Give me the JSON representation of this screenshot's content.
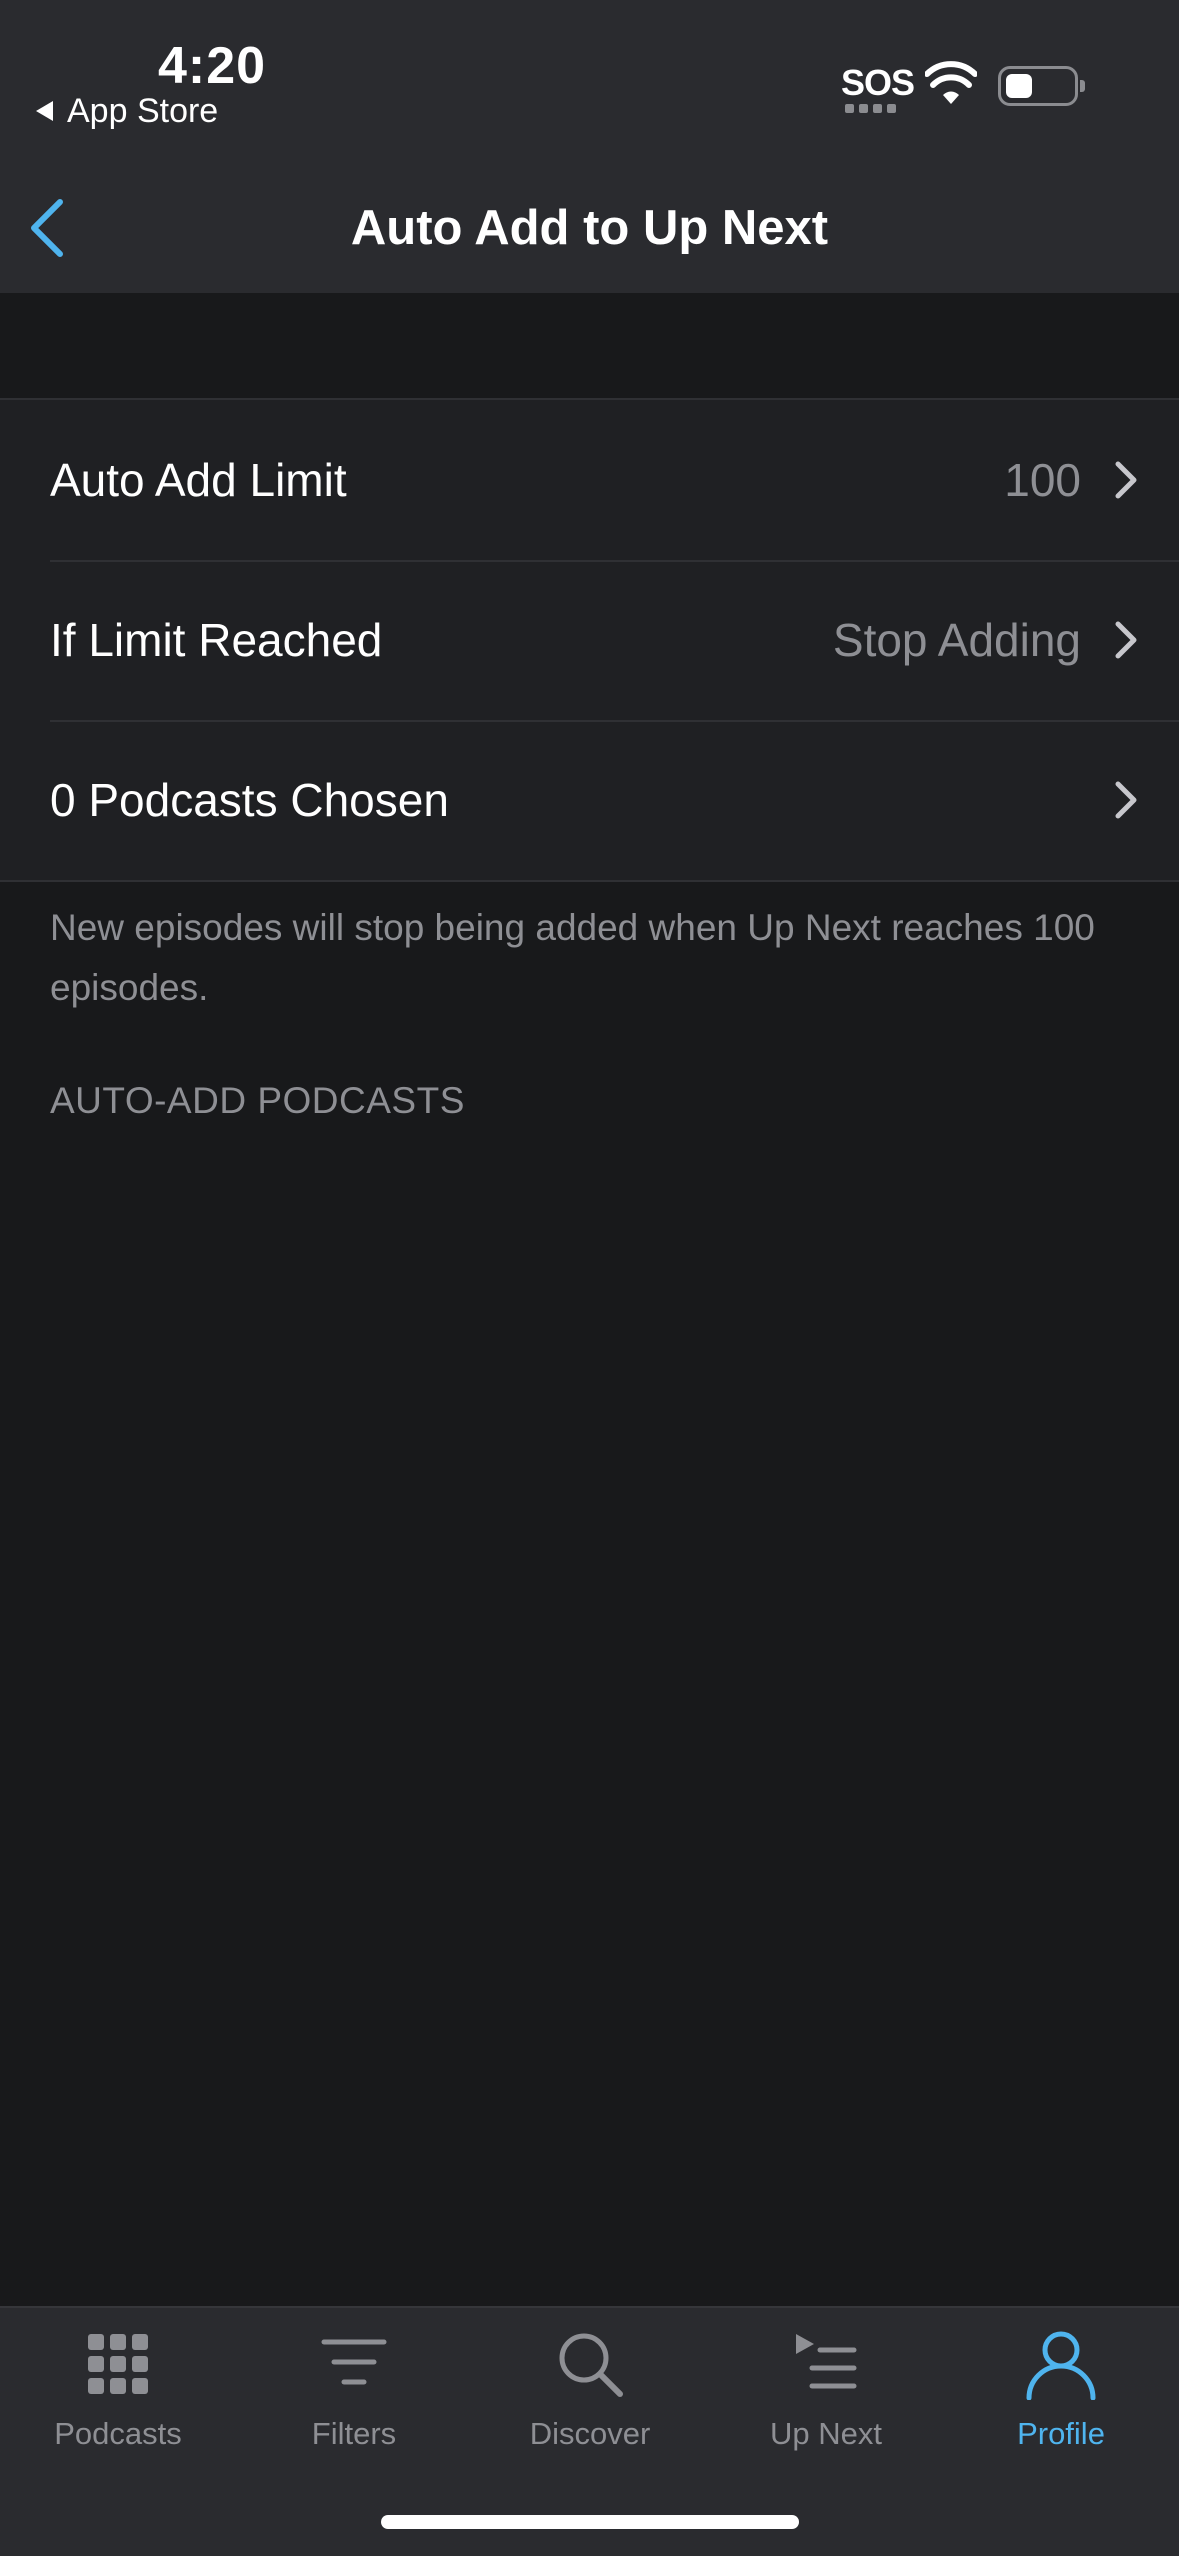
{
  "status_bar": {
    "time": "4:20",
    "back_app": "App Store",
    "sos": "SOS"
  },
  "nav": {
    "title": "Auto Add to Up Next"
  },
  "settings": {
    "rows": [
      {
        "label": "Auto Add Limit",
        "value": "100"
      },
      {
        "label": "If Limit Reached",
        "value": "Stop Adding"
      },
      {
        "label": "0 Podcasts Chosen",
        "value": ""
      }
    ],
    "footer_note": "New episodes will stop being added when Up Next reaches 100 episodes.",
    "section_header": "AUTO-ADD PODCASTS"
  },
  "tabbar": {
    "tabs": [
      {
        "label": "Podcasts",
        "icon": "grid-icon"
      },
      {
        "label": "Filters",
        "icon": "filter-icon"
      },
      {
        "label": "Discover",
        "icon": "search-icon"
      },
      {
        "label": "Up Next",
        "icon": "up-next-icon"
      },
      {
        "label": "Profile",
        "icon": "profile-icon",
        "active": true
      }
    ]
  },
  "colors": {
    "background": "#18191b",
    "header": "#2a2b2f",
    "accent": "#4fb4ee",
    "secondary_text": "#8e8f94"
  }
}
